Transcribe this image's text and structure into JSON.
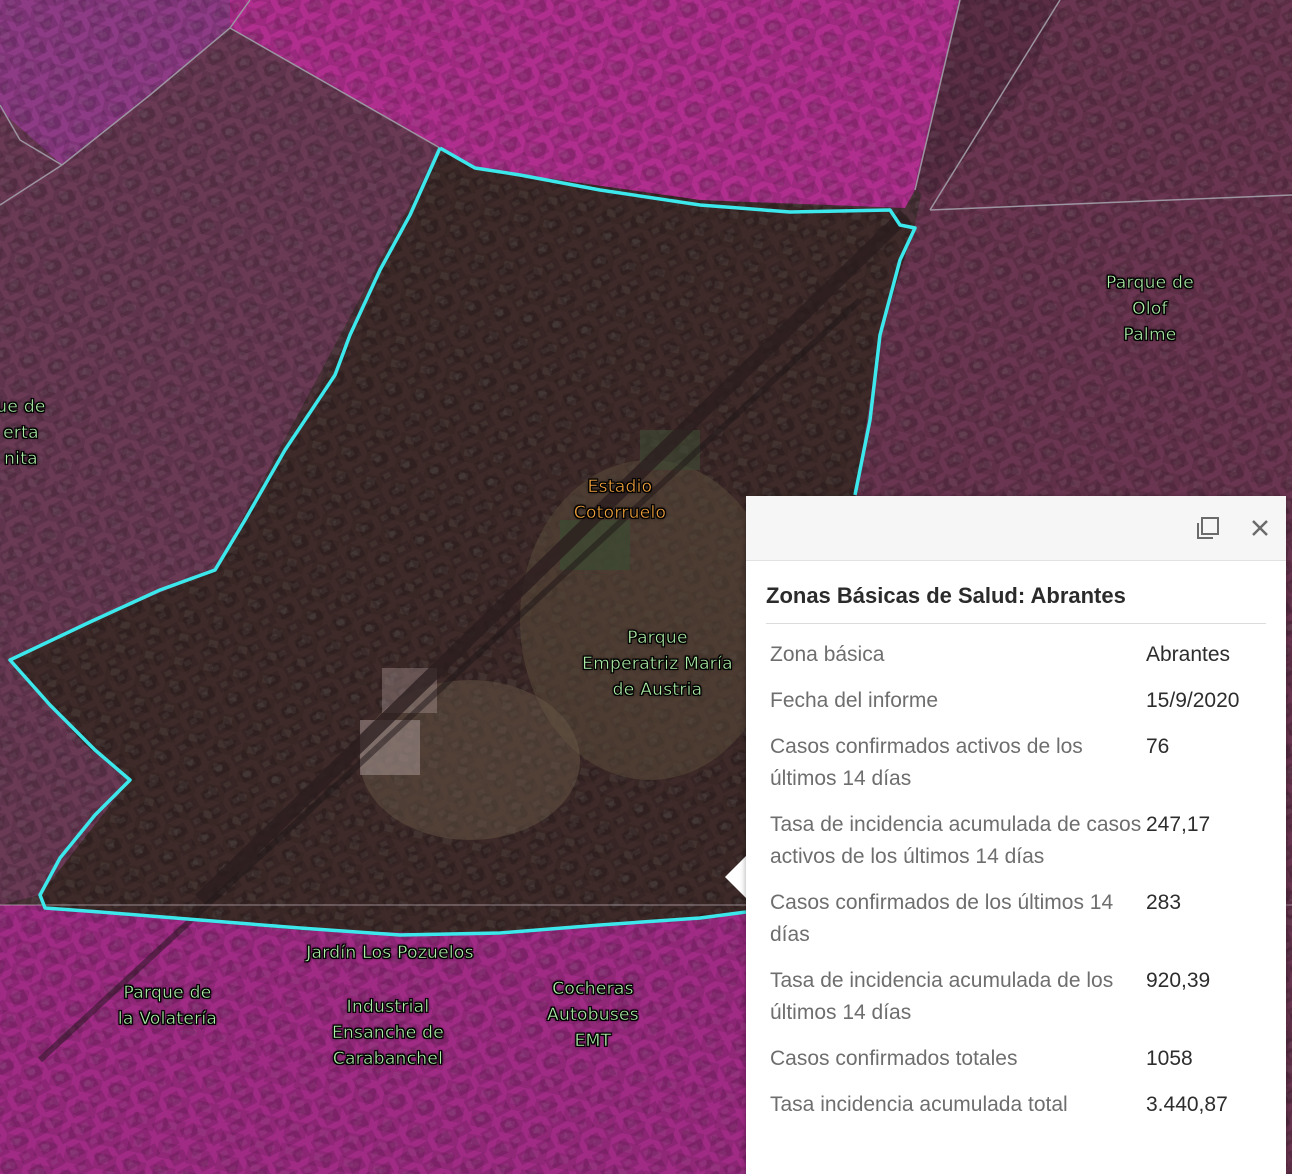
{
  "map": {
    "labels": [
      {
        "id": "olof-palme",
        "text": "Parque de\nOlof\nPalme",
        "color": "green"
      },
      {
        "id": "huerta",
        "text": "ue de\nerta\nnita",
        "color": "green"
      },
      {
        "id": "estadio",
        "text": "Estadio\nCotorruelo",
        "color": "orange"
      },
      {
        "id": "emperatriz",
        "text": "Parque\nEmperatriz María\nde Austria",
        "color": "green"
      },
      {
        "id": "pozuelos",
        "text": "Jardín Los Pozuelos",
        "color": "green"
      },
      {
        "id": "volateria",
        "text": "Parque de\nla Volatería",
        "color": "green"
      },
      {
        "id": "industrial",
        "text": "Industrial\nEnsanche de\nCarabanchel",
        "color": "green"
      },
      {
        "id": "cocheras",
        "text": "Cocheras\nAutobuses\nEMT",
        "color": "green"
      }
    ],
    "colors": {
      "boundary": "#3ce8ec",
      "zone_magenta": "#b0288a",
      "selected_zone": "#3b2a26",
      "label_green": "#aef0a8",
      "label_orange": "#f0a23c"
    }
  },
  "popup": {
    "title": "Zonas Básicas de Salud: Abrantes",
    "maximize_icon": "maximize-icon",
    "close_icon": "close-icon",
    "rows": [
      {
        "name": "Zona básica",
        "value": "Abrantes"
      },
      {
        "name": "Fecha del informe",
        "value": "15/9/2020"
      },
      {
        "name": "Casos confirmados activos de los últimos 14 días",
        "value": "76"
      },
      {
        "name": "Tasa de incidencia acumulada de casos activos de los últimos 14 días",
        "value": "247,17"
      },
      {
        "name": "Casos confirmados de los últimos 14 días",
        "value": "283"
      },
      {
        "name": "Tasa de incidencia acumulada de los últimos 14 días",
        "value": "920,39"
      },
      {
        "name": "Casos confirmados totales",
        "value": "1058"
      },
      {
        "name": "Tasa incidencia acumulada total",
        "value": "3.440,87"
      }
    ]
  }
}
